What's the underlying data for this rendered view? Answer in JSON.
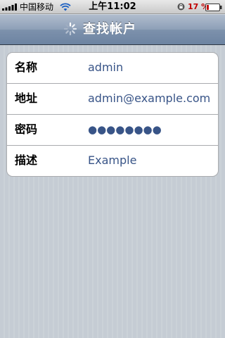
{
  "status_bar": {
    "carrier": "中国移动",
    "time": "上午11:02",
    "battery_percent": "17 %",
    "signal_icon": "signal-bars-icon",
    "wifi_icon": "wifi-icon",
    "lock_icon": "rotation-lock-icon",
    "battery_icon": "battery-icon",
    "battery_level": 0.17,
    "battery_color": "#c00000"
  },
  "nav_bar": {
    "title": "查找帐户",
    "spinner_icon": "activity-spinner-icon"
  },
  "form": {
    "rows": [
      {
        "label": "名称",
        "value": "admin"
      },
      {
        "label": "地址",
        "value": "admin@example.com"
      },
      {
        "label": "密码",
        "value": "●●●●●●●●",
        "masked": true
      },
      {
        "label": "描述",
        "value": "Example"
      }
    ]
  },
  "colors": {
    "value_text": "#385487",
    "nav_bar": "#6d84a2",
    "background": "#c5ccd4"
  }
}
